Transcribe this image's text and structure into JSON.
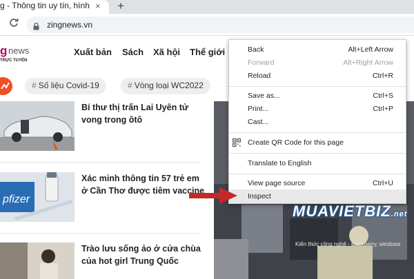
{
  "browser": {
    "tab_title": "g - Thông tin uy tín, hình ảnh",
    "tab_close": "×",
    "new_tab": "+",
    "reload": "C",
    "url": "zingnews.vn"
  },
  "site": {
    "logo_mark": "g",
    "logo_name": "news",
    "logo_sub": "TRỰC TUYẾN",
    "nav": [
      "Xuất bản",
      "Sách",
      "Xã hội",
      "Thể giới"
    ]
  },
  "tags": {
    "hash": "#",
    "items": [
      "Số liệu Covid-19",
      "Vòng loại WC2022"
    ]
  },
  "articles": [
    {
      "title": "Bí thư thị trấn Lai Uyên tử vong trong ôtô"
    },
    {
      "title": "Xác minh thông tin 57 trẻ em ở Cần Thơ được tiêm vaccine"
    },
    {
      "title": "Trào lưu sống ảo ở cửa chùa của hot girl Trung Quốc"
    }
  ],
  "thumb_text": "pfizer",
  "watermark": {
    "main": "MUAVIETBIZ",
    "suffix": ".net",
    "sub": "Kiến thức công nghệ - blackberry, windows"
  },
  "context_menu": {
    "groups": [
      [
        {
          "label": "Back",
          "shortcut": "Alt+Left Arrow",
          "disabled": false
        },
        {
          "label": "Forward",
          "shortcut": "Alt+Right Arrow",
          "disabled": true
        },
        {
          "label": "Reload",
          "shortcut": "Ctrl+R",
          "disabled": false
        }
      ],
      [
        {
          "label": "Save as...",
          "shortcut": "Ctrl+S",
          "disabled": false
        },
        {
          "label": "Print...",
          "shortcut": "Ctrl+P",
          "disabled": false
        },
        {
          "label": "Cast...",
          "shortcut": "",
          "disabled": false
        }
      ],
      [
        {
          "label": "Create QR Code for this page",
          "shortcut": "",
          "icon": "qr-code-icon"
        }
      ],
      [
        {
          "label": "Translate to English",
          "shortcut": ""
        }
      ],
      [
        {
          "label": "View page source",
          "shortcut": "Ctrl+U"
        },
        {
          "label": "Inspect",
          "shortcut": "",
          "highlighted": true
        }
      ]
    ]
  },
  "colors": {
    "brand": "#b5005a",
    "arrow": "#c62828",
    "tab_strip": "#dee1e6"
  }
}
